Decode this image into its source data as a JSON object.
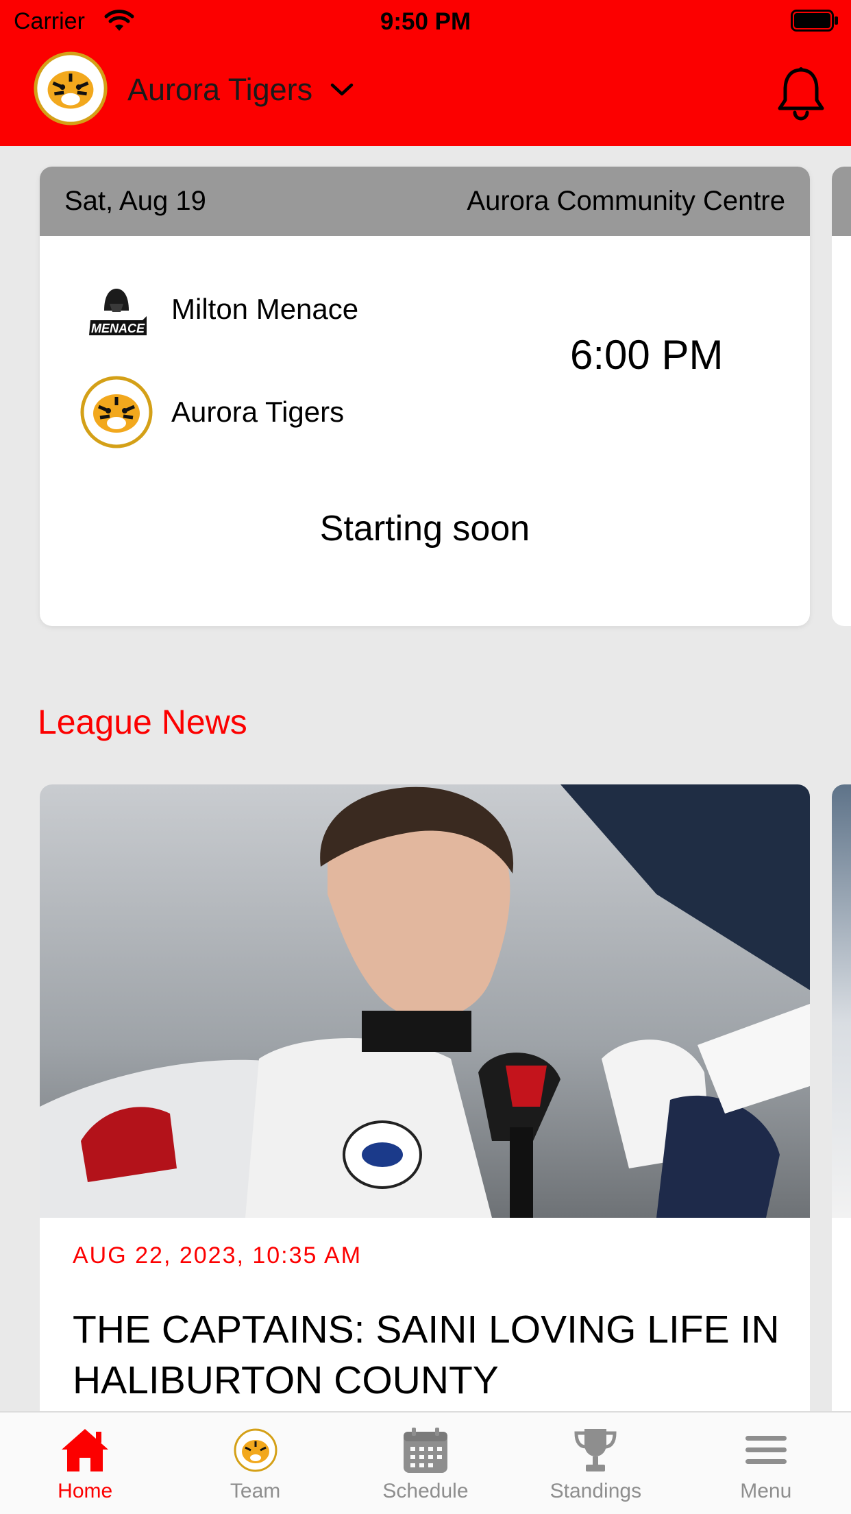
{
  "status_bar": {
    "carrier": "Carrier",
    "time": "9:50 PM"
  },
  "header": {
    "team_name": "Aurora Tigers"
  },
  "colors": {
    "brand_red": "#fc0000",
    "card_header_gray": "#999999",
    "tab_inactive": "#8e8e8e"
  },
  "game": {
    "date": "Sat, Aug 19",
    "venue": "Aurora Community Centre",
    "away_team": "Milton Menace",
    "away_logo_text": "MENACE",
    "home_team": "Aurora Tigers",
    "time": "6:00 PM",
    "status": "Starting soon"
  },
  "league_news": {
    "title": "League News",
    "articles": [
      {
        "date": "AUG 22, 2023, 10:35 AM",
        "headline": "THE CAPTAINS: SAINI LOVING LIFE IN HALIBURTON COUNTY"
      }
    ]
  },
  "tabs": [
    {
      "label": "Home",
      "icon": "home-icon",
      "active": true
    },
    {
      "label": "Team",
      "icon": "team-logo-icon",
      "active": false
    },
    {
      "label": "Schedule",
      "icon": "calendar-icon",
      "active": false
    },
    {
      "label": "Standings",
      "icon": "trophy-icon",
      "active": false
    },
    {
      "label": "Menu",
      "icon": "menu-icon",
      "active": false
    }
  ]
}
